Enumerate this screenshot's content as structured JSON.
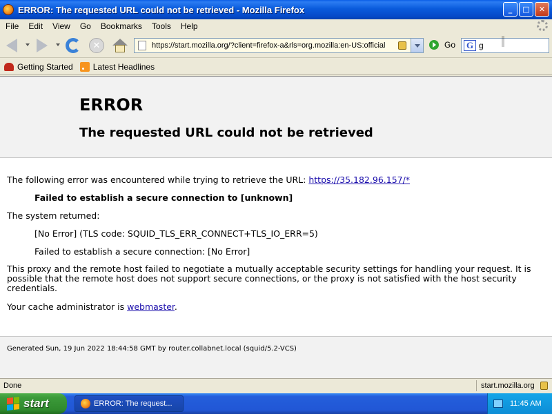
{
  "window": {
    "title": "ERROR: The requested URL could not be retrieved - Mozilla Firefox",
    "controls": {
      "minimize": "_",
      "maximize": "□",
      "close": "✕"
    }
  },
  "menu": [
    "File",
    "Edit",
    "View",
    "Go",
    "Bookmarks",
    "Tools",
    "Help"
  ],
  "nav": {
    "url": "https://start.mozilla.org/?client=firefox-a&rls=org.mozilla:en-US:official",
    "go_label": "Go",
    "search_value": "g"
  },
  "bookmarks": [
    "Getting Started",
    "Latest Headlines"
  ],
  "page": {
    "title": "ERROR",
    "subtitle": "The requested URL could not be retrieved",
    "intro": "The following error was encountered while trying to retrieve the URL: ",
    "intro_link": "https://35.182.96.157/*",
    "error_line": "Failed to establish a secure connection to [unknown]",
    "system_returned": "The system returned:",
    "tls_error": "[No Error] (TLS code: SQUID_TLS_ERR_CONNECT+TLS_IO_ERR=5)",
    "conn_error": "Failed to establish a secure connection: [No Error]",
    "explanation": "This proxy and the remote host failed to negotiate a mutually acceptable security settings for handling your request. It is possible that the remote host does not support secure connections, or the proxy is not satisfied with the host security credentials.",
    "admin_text": "Your cache administrator is ",
    "admin_link": "webmaster",
    "admin_end": ".",
    "footer": "Generated Sun, 19 Jun 2022 18:44:58 GMT by router.collabnet.local (squid/5.2-VCS)"
  },
  "status": {
    "left": "Done",
    "right": "start.mozilla.org"
  },
  "taskbar": {
    "start_label": "start",
    "task_label": "ERROR: The request...",
    "clock": "11:45 AM"
  },
  "colors": {
    "link": "#1a0dab",
    "titlebar": "#0a5bdc",
    "taskbar": "#2157d6",
    "start": "#3c9a3a"
  }
}
